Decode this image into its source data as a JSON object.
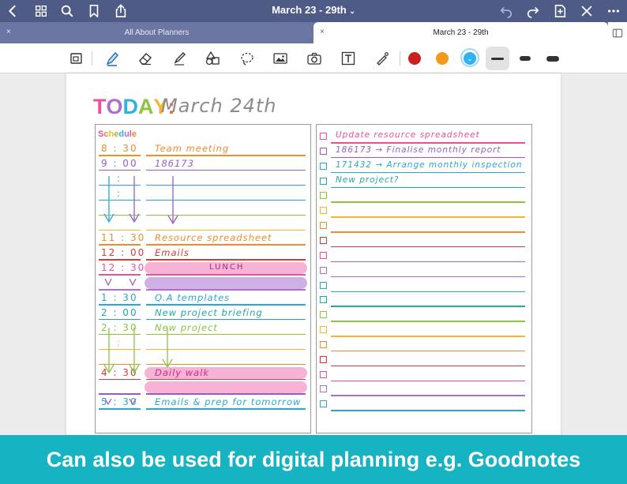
{
  "navbar": {
    "title": "March 23 - 29th",
    "icons": [
      "back-icon",
      "grid-icon",
      "search-icon",
      "bookmark-icon",
      "share-icon",
      "undo-icon",
      "redo-icon",
      "add-page-icon",
      "close-icon",
      "more-icon"
    ]
  },
  "tabs": [
    {
      "label": "All About Planners",
      "close": "×",
      "active": false
    },
    {
      "label": "March 23 - 29th",
      "close": "×",
      "active": true
    }
  ],
  "toolbar": {
    "tools": [
      "zoom-window-icon",
      "pen-icon",
      "eraser-icon",
      "highlighter-icon",
      "shapes-icon",
      "lasso-icon",
      "image-icon",
      "camera-icon",
      "text-icon",
      "laser-icon"
    ],
    "colors": [
      "#cc1f1f",
      "#f39a1a",
      "#2fb2f0"
    ],
    "strokes": [
      "thin",
      "medium",
      "thick"
    ]
  },
  "planner": {
    "today_letters": [
      "T",
      "O",
      "D",
      "A",
      "Y",
      ":"
    ],
    "today_colors": [
      "#e9519b",
      "#ab6fd0",
      "#2fb3e0",
      "#8cc43f",
      "#f5b62d",
      "#ef6f3b"
    ],
    "date_handwritten": "March 24th",
    "schedule_label": "Schedule",
    "schedule_label_colors": [
      "#e9519b",
      "#f0862f",
      "#f5b62d",
      "#8cc43f",
      "#2fb3e0",
      "#ab6fd0",
      "#e9519b",
      "#f0862f"
    ],
    "schedule": [
      {
        "time": "8 : 30",
        "task": "Team meeting",
        "color": "#f08b2f"
      },
      {
        "time": "9 : 00",
        "task": "186173",
        "color": "#9b59c6"
      },
      {
        "time": ":",
        "task": "",
        "color": "#2aa6d8"
      },
      {
        "time": ":",
        "task": "",
        "color": "#2aa6d8"
      },
      {
        "time": "",
        "task": "",
        "color": "#8cc43f"
      },
      {
        "time": "",
        "task": "",
        "color": "#f5b62d"
      },
      {
        "time": "11 : 30",
        "task": "Resource spreadsheet",
        "color": "#f08b2f"
      },
      {
        "time": "12 : 00",
        "task": "Emails",
        "color": "#d63a3a"
      },
      {
        "time": "12 : 30",
        "task": "LUNCH",
        "color": "#e9519b"
      },
      {
        "time": "",
        "task": "",
        "color": "#ab6fd0"
      },
      {
        "time": "1 : 30",
        "task": "Q.A templates",
        "color": "#2aa6d8"
      },
      {
        "time": "2 : 00",
        "task": "New project briefing",
        "color": "#21a8a8"
      },
      {
        "time": "2 : 30",
        "task": "New project",
        "color": "#8cc43f"
      },
      {
        "time": ":",
        "task": "",
        "color": "#f5b62d"
      },
      {
        "time": "",
        "task": "",
        "color": "#f08b2f"
      },
      {
        "time": "4 : 30",
        "task": "Daily walk",
        "color": "#d63a3a"
      },
      {
        "time": "",
        "task": "",
        "color": "#9b59c6"
      },
      {
        "time": "5 : 30",
        "task": "Emails & prep for tomorrow",
        "color": "#2aa6d8"
      }
    ],
    "todos": [
      {
        "text": "Update resource spreadsheet",
        "color": "#e9519b"
      },
      {
        "text": "186173 → Finalise monthly report",
        "color": "#9b59c6"
      },
      {
        "text": "171432 → Arrange monthly inspection",
        "color": "#2aa6d8"
      },
      {
        "text": "New project?",
        "color": "#21a8a8"
      },
      {
        "text": "",
        "color": "#8cc43f"
      },
      {
        "text": "",
        "color": "#f5b62d"
      },
      {
        "text": "",
        "color": "#f08b2f"
      },
      {
        "text": "",
        "color": "#d63a3a"
      },
      {
        "text": "",
        "color": "#e9519b"
      },
      {
        "text": "",
        "color": "#ab6fd0"
      },
      {
        "text": "",
        "color": "#2aa6d8"
      },
      {
        "text": "",
        "color": "#21a8a8"
      },
      {
        "text": "",
        "color": "#8cc43f"
      },
      {
        "text": "",
        "color": "#f5b62d"
      },
      {
        "text": "",
        "color": "#f08b2f"
      },
      {
        "text": "",
        "color": "#d63a3a"
      },
      {
        "text": "",
        "color": "#e9519b"
      },
      {
        "text": "",
        "color": "#ab6fd0"
      },
      {
        "text": "",
        "color": "#2aa6d8"
      }
    ]
  },
  "banner": {
    "text": "Can also be used for digital planning e.g. Goodnotes"
  }
}
